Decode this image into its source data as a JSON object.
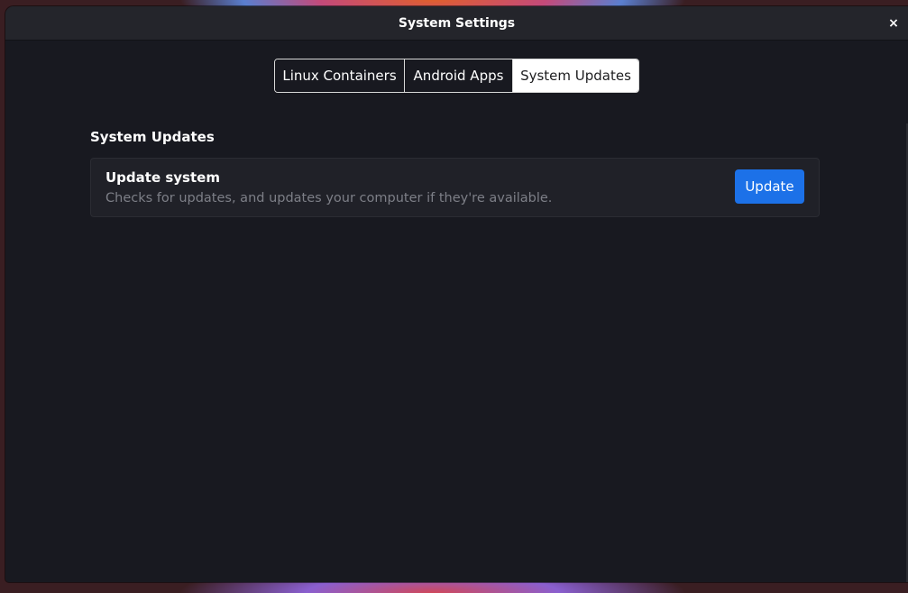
{
  "window": {
    "title": "System Settings",
    "close_symbol": "×"
  },
  "tabs": [
    {
      "label": "Linux Containers",
      "active": false
    },
    {
      "label": "Android Apps",
      "active": false
    },
    {
      "label": "System Updates",
      "active": true
    }
  ],
  "section": {
    "title": "System Updates"
  },
  "update_card": {
    "title": "Update system",
    "description": "Checks for updates, and updates your computer if they're available.",
    "button_label": "Update"
  },
  "colors": {
    "accent": "#1c71e8",
    "window_bg": "#181920",
    "card_bg": "#202128",
    "titlebar_bg": "#24252b"
  },
  "icons": {
    "close": "close-icon"
  }
}
